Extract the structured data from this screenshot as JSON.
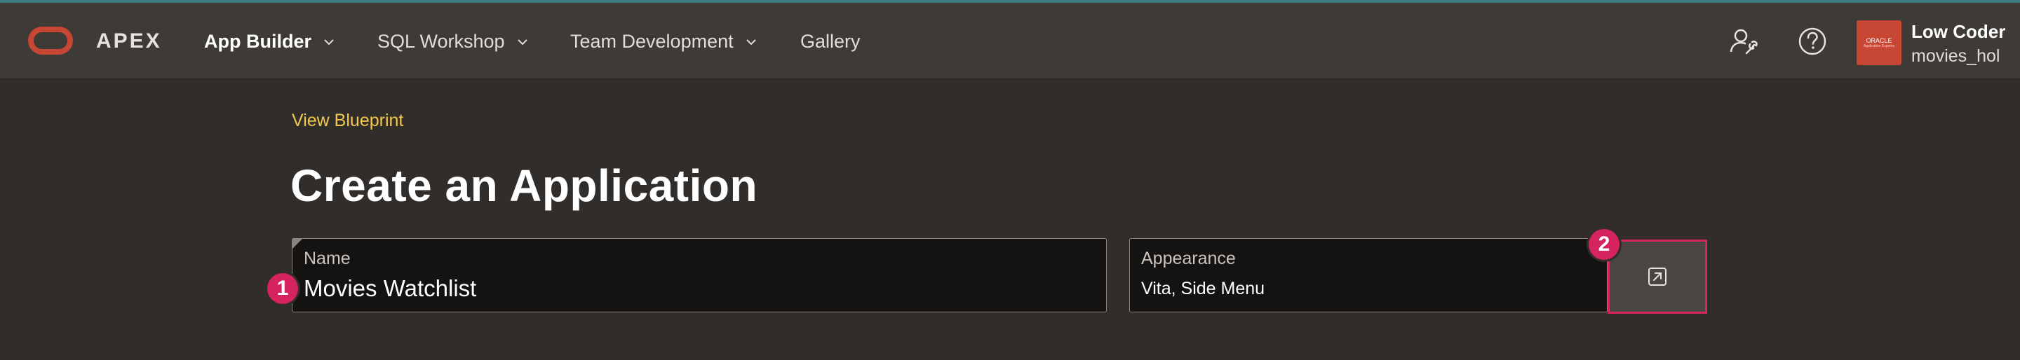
{
  "header": {
    "brand": "APEX",
    "nav": [
      {
        "label": "App Builder",
        "has_dropdown": true,
        "active": true
      },
      {
        "label": "SQL Workshop",
        "has_dropdown": true,
        "active": false
      },
      {
        "label": "Team Development",
        "has_dropdown": true,
        "active": false
      },
      {
        "label": "Gallery",
        "has_dropdown": false,
        "active": false
      }
    ],
    "icons": [
      "administration-icon",
      "help-icon"
    ],
    "avatar": {
      "line1": "ORACLE",
      "line2": "Application Express"
    },
    "user": {
      "name": "Low Coder",
      "workspace": "movies_hol"
    }
  },
  "main": {
    "blueprint_link": "View Blueprint",
    "title": "Create an Application",
    "name_field": {
      "label": "Name",
      "value": "Movies Watchlist"
    },
    "appearance_field": {
      "label": "Appearance",
      "value": "Vita, Side Menu"
    }
  },
  "callouts": [
    "1",
    "2"
  ],
  "colors": {
    "header_bg": "#3e3a36",
    "page_bg": "#312d2a",
    "link": "#f2c94c",
    "callout": "#d6245f",
    "brand_red": "#c74634"
  }
}
